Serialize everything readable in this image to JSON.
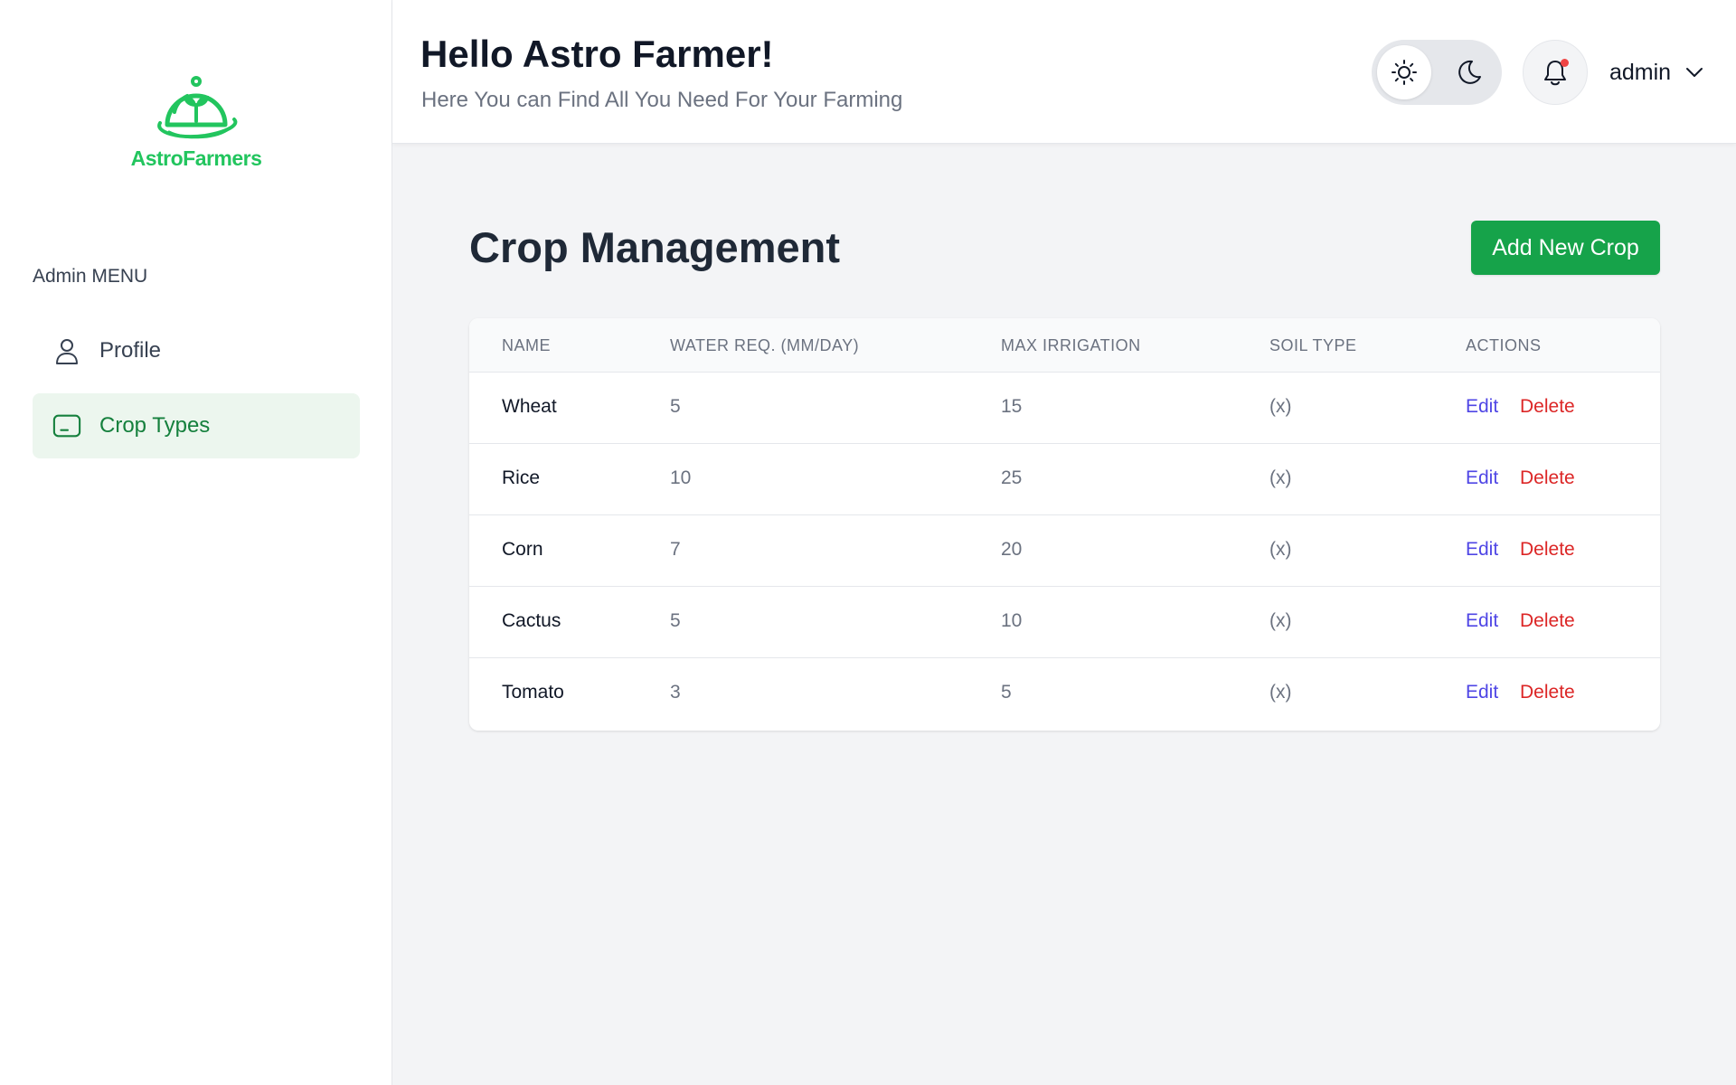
{
  "brand": {
    "name": "AstroFarmers",
    "color": "#22c55e",
    "logo_icon": "greenhouse-sprout-icon"
  },
  "sidebar": {
    "heading": "Admin MENU",
    "items": [
      {
        "label": "Profile",
        "icon": "user-icon",
        "active": false
      },
      {
        "label": "Crop Types",
        "icon": "crop-types-icon",
        "active": true
      }
    ]
  },
  "header": {
    "greeting": "Hello Astro Farmer!",
    "subtitle": "Here You can Find All You Need For Your Farming",
    "theme": {
      "light_icon": "sun-icon",
      "dark_icon": "moon-icon",
      "selected": "light"
    },
    "notifications": {
      "icon": "bell-icon",
      "has_unread": true
    },
    "user": {
      "name": "admin",
      "icon": "chevron-down-icon"
    }
  },
  "main": {
    "title": "Crop Management",
    "add_button": "Add New Crop",
    "table": {
      "columns": [
        "NAME",
        "WATER REQ. (MM/DAY)",
        "MAX IRRIGATION",
        "SOIL TYPE",
        "ACTIONS"
      ],
      "rows": [
        {
          "name": "Wheat",
          "water": "5",
          "irrigation": "15",
          "soil": "(x)",
          "edit": "Edit",
          "delete": "Delete"
        },
        {
          "name": "Rice",
          "water": "10",
          "irrigation": "25",
          "soil": "(x)",
          "edit": "Edit",
          "delete": "Delete"
        },
        {
          "name": "Corn",
          "water": "7",
          "irrigation": "20",
          "soil": "(x)",
          "edit": "Edit",
          "delete": "Delete"
        },
        {
          "name": "Cactus",
          "water": "5",
          "irrigation": "10",
          "soil": "(x)",
          "edit": "Edit",
          "delete": "Delete"
        },
        {
          "name": "Tomato",
          "water": "3",
          "irrigation": "5",
          "soil": "(x)",
          "edit": "Edit",
          "delete": "Delete"
        }
      ]
    }
  },
  "colors": {
    "accent_green": "#16a34a",
    "active_nav_bg": "#ecf6ee",
    "edit_link": "#4f46e5",
    "delete_link": "#dc2626",
    "notification_dot": "#ef4444"
  }
}
